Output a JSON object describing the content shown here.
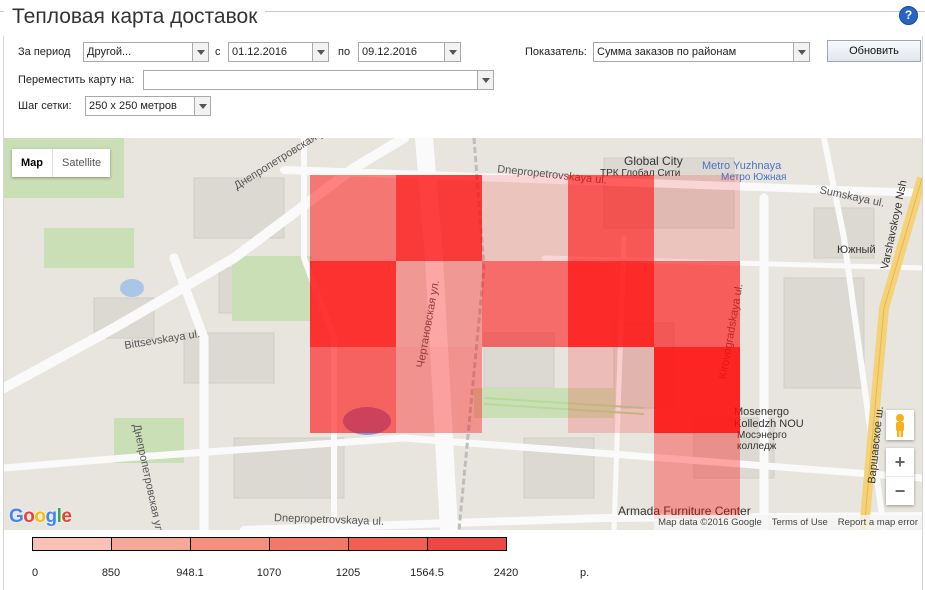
{
  "page": {
    "title": "Тепловая карта доставок",
    "help": "?"
  },
  "filters": {
    "period_label": "За период",
    "period_value": "Другой...",
    "from_label": "с",
    "from_value": "01.12.2016",
    "to_label": "по",
    "to_value": "09.12.2016",
    "metric_label": "Показатель:",
    "metric_value": "Сумма заказов по районам",
    "update_button": "Обновить",
    "move_label": "Переместить карту на:",
    "move_value": "",
    "grid_label": "Шаг сетки:",
    "grid_value": "250 x 250 метров"
  },
  "map": {
    "type_map": "Map",
    "type_satellite": "Satellite",
    "zoom_in": "+",
    "zoom_out": "−",
    "google": "Google",
    "attribution": {
      "data": "Map data ©2016 Google",
      "terms": "Terms of Use",
      "report": "Report a map error"
    },
    "labels": {
      "dnepr_ul_top": "Днепропетровская ул.",
      "bittsevskaya": "Bittsevskaya ul.",
      "dnepr_ul_left": "Днепропетровская ул.",
      "dnepropetrovskaya_en_top": "Dnepropetrovskaya ul.",
      "chertanovskaya": "Чертановская ул.",
      "dnepropetrovskaya_en_bottom": "Dnepropetrovskaya ul.",
      "global_city": "Global City",
      "trk": "ТРК Глобал Сити",
      "metro_en": "Metro Yuzhnaya",
      "metro_ru": "Метро Южная",
      "sumskaya": "Sumskaya ul.",
      "yuzhny": "Южный",
      "kirovogradskaya": "Kirovogradskaya ul.",
      "varshavskoye_top": "Varshavskoye Nsh",
      "varshavskoye_ru": "Варшавское ш.",
      "mosenergo_en": "Mosenergo Kolledzh NOU",
      "mosenergo_ru": "Мосэнерго колледж",
      "armada": "Armada Furniture Center"
    },
    "heat_cells": [
      {
        "row": 0,
        "col": 0,
        "opacity": 0.5
      },
      {
        "row": 0,
        "col": 1,
        "opacity": 0.78
      },
      {
        "row": 0,
        "col": 2,
        "opacity": 0.15
      },
      {
        "row": 0,
        "col": 3,
        "opacity": 0.65
      },
      {
        "row": 0,
        "col": 4,
        "opacity": 0.15
      },
      {
        "row": 1,
        "col": 0,
        "opacity": 0.82
      },
      {
        "row": 1,
        "col": 1,
        "opacity": 0.35
      },
      {
        "row": 1,
        "col": 2,
        "opacity": 0.55
      },
      {
        "row": 1,
        "col": 3,
        "opacity": 0.85
      },
      {
        "row": 1,
        "col": 4,
        "opacity": 0.62
      },
      {
        "row": 2,
        "col": 0,
        "opacity": 0.6
      },
      {
        "row": 2,
        "col": 1,
        "opacity": 0.38
      },
      {
        "row": 2,
        "col": 3,
        "opacity": 0.18
      },
      {
        "row": 2,
        "col": 4,
        "opacity": 0.88
      },
      {
        "row": 3,
        "col": 4,
        "opacity": 0.35
      }
    ]
  },
  "legend": {
    "colors": [
      "#f8c3b6",
      "#f6a897",
      "#f48f7e",
      "#f37868",
      "#f05f51",
      "#ed4744"
    ],
    "ticks": [
      "0",
      "850",
      "948.1",
      "1070",
      "1205",
      "1564.5",
      "2420"
    ],
    "unit": "р."
  }
}
